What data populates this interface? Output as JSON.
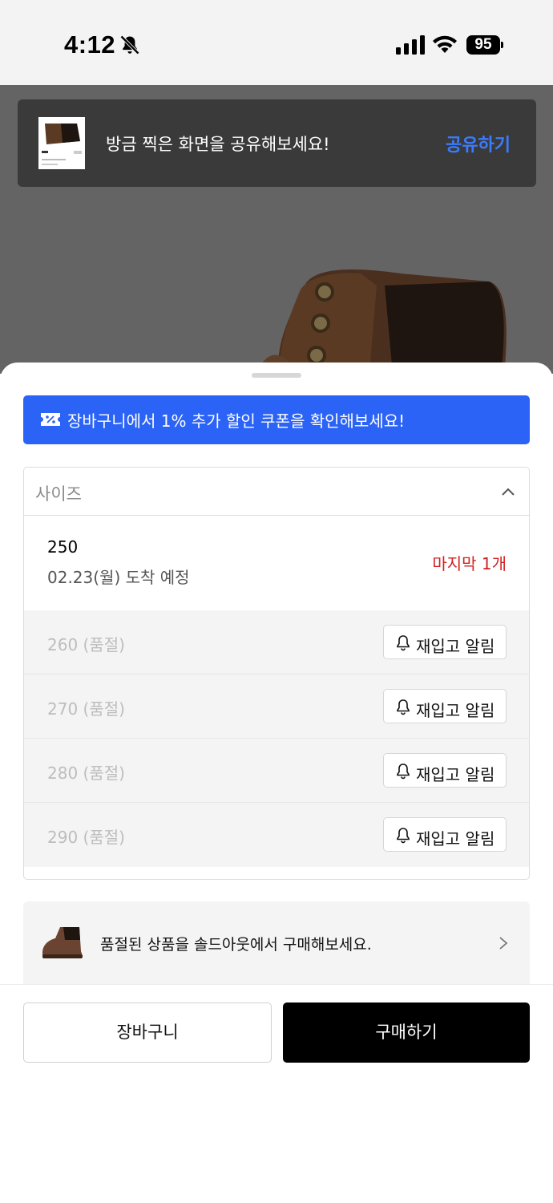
{
  "status_bar": {
    "time": "4:12",
    "battery": "95"
  },
  "toast": {
    "message": "방금 찍은 화면을 공유해보세요!",
    "share_label": "공유하기"
  },
  "coupon_banner": {
    "text": "장바구니에서 1% 추가 할인 쿠폰을 확인해보세요!"
  },
  "size_selector": {
    "label": "사이즈",
    "available_option": {
      "size": "250",
      "arrival": "02.23(월) 도착 예정",
      "stock": "마지막 1개"
    },
    "soldout_options": [
      {
        "label": "260 (품절)",
        "button": "재입고 알림"
      },
      {
        "label": "270 (품절)",
        "button": "재입고 알림"
      },
      {
        "label": "280 (품절)",
        "button": "재입고 알림"
      },
      {
        "label": "290 (품절)",
        "button": "재입고 알림"
      }
    ]
  },
  "soldout_banner": {
    "text": "품절된 상품을 솔드아웃에서 구매해보세요."
  },
  "actions": {
    "cart_label": "장바구니",
    "buy_label": "구매하기"
  },
  "colors": {
    "accent_blue": "#2b63f6",
    "share_blue": "#3b7cff",
    "stock_red": "#d32020"
  }
}
